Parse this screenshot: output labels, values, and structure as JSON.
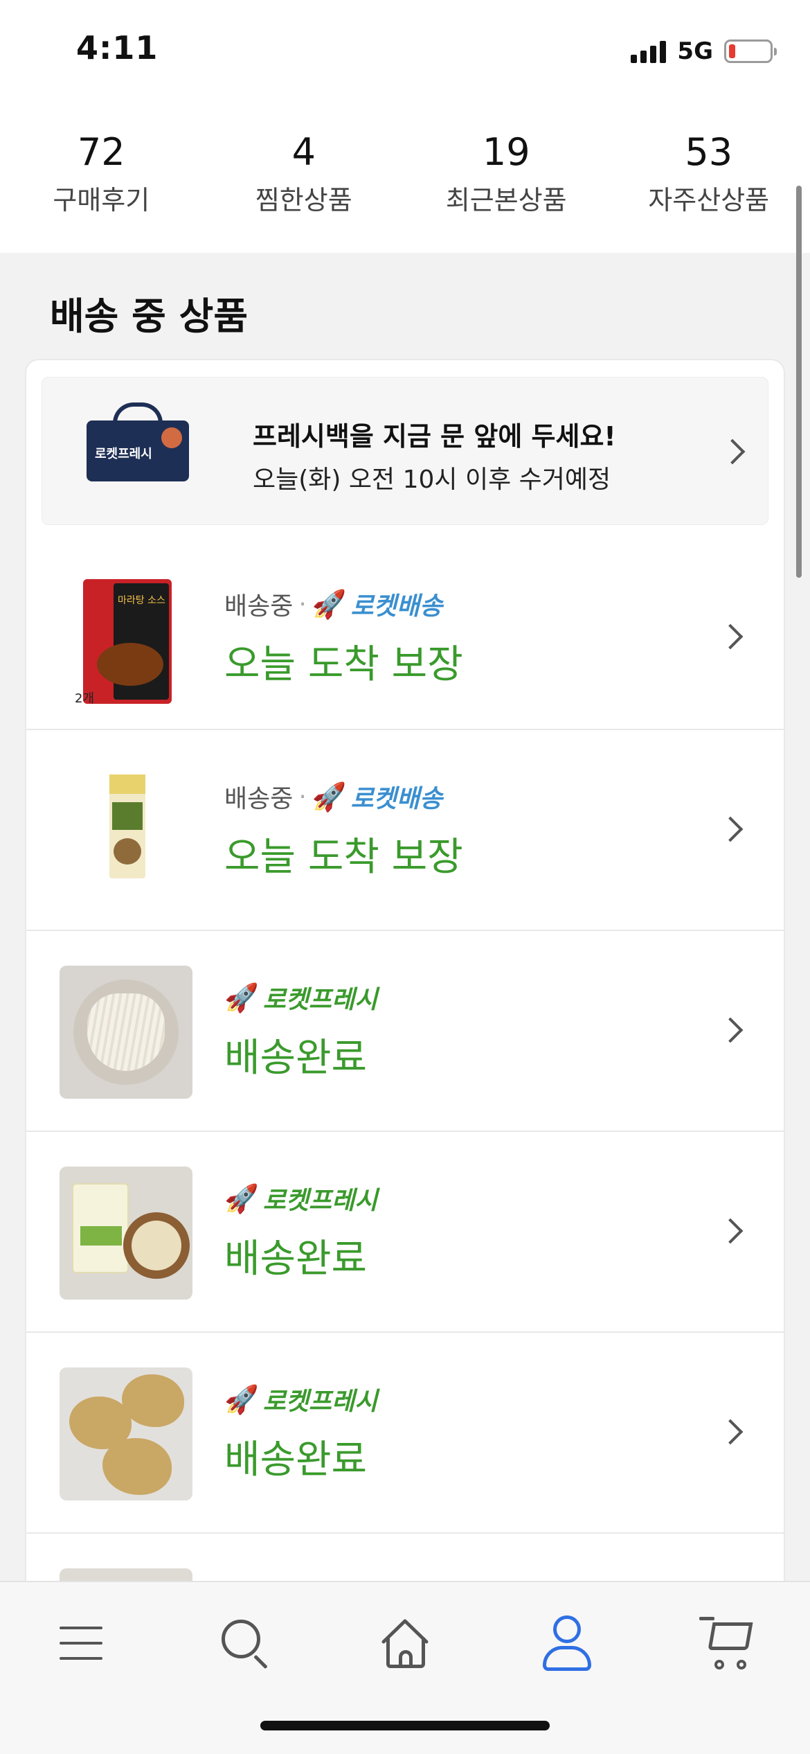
{
  "status_bar": {
    "time": "4:11",
    "network": "5G"
  },
  "stats": [
    {
      "count": "72",
      "label": "구매후기"
    },
    {
      "count": "4",
      "label": "찜한상품"
    },
    {
      "count": "19",
      "label": "최근본상품"
    },
    {
      "count": "53",
      "label": "자주산상품"
    }
  ],
  "section": {
    "title": "배송 중 상품"
  },
  "banner": {
    "title": "프레시백을 지금 문 앞에 두세요!",
    "subtitle": "오늘(화) 오전 10시 이후 수거예정",
    "bag_label": "로켓프레시"
  },
  "items": [
    {
      "state": "배송중",
      "badge": "로켓배송",
      "status": "오늘 도착 보장",
      "thumb_badge": "2개"
    },
    {
      "state": "배송중",
      "badge": "로켓배송",
      "status": "오늘 도착 보장"
    },
    {
      "badge": "로켓프레시",
      "status": "배송완료"
    },
    {
      "badge": "로켓프레시",
      "status": "배송완료"
    },
    {
      "badge": "로켓프레시",
      "status": "배송완료"
    }
  ],
  "bottom_nav": [
    {
      "icon": "menu-icon"
    },
    {
      "icon": "search-icon"
    },
    {
      "icon": "home-icon"
    },
    {
      "icon": "user-icon",
      "active": true
    },
    {
      "icon": "cart-icon"
    }
  ],
  "colors": {
    "green_status": "#3a9a2c",
    "blue_badge": "#3b8fd0",
    "active_nav": "#2f6fe4",
    "battery_low": "#e53b30"
  }
}
